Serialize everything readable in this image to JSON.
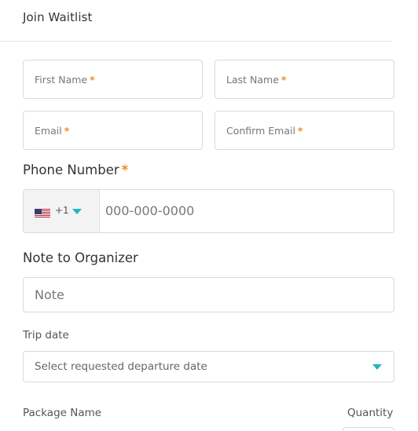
{
  "header": {
    "title": "Join Waitlist"
  },
  "form": {
    "first_name": {
      "placeholder": "First Name",
      "required_mark": "*"
    },
    "last_name": {
      "placeholder": "Last Name",
      "required_mark": "*"
    },
    "email": {
      "placeholder": "Email",
      "required_mark": "*"
    },
    "confirm_email": {
      "placeholder": "Confirm Email",
      "required_mark": "*"
    },
    "phone": {
      "label": "Phone Number",
      "required_mark": "*",
      "dial_code": "+1",
      "flag_icon": "us-flag-icon",
      "placeholder": "000-000-0000"
    },
    "note": {
      "label": "Note to Organizer",
      "placeholder": "Note"
    },
    "trip_date": {
      "label": "Trip date",
      "placeholder": "Select requested departure date"
    },
    "package": {
      "name_label": "Package Name",
      "quantity_label": "Quantity"
    }
  },
  "colors": {
    "required": "#f08a24",
    "caret": "#26b3c6",
    "border": "#d9d9d9"
  }
}
